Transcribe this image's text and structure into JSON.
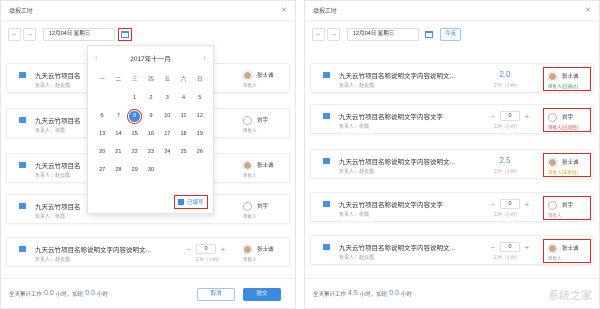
{
  "left": {
    "title": "填报工时",
    "date": "12月04日  星期三",
    "calendar": {
      "month_label": "2017年十一月",
      "weekdays": [
        "一",
        "二",
        "三",
        "四",
        "五",
        "六",
        "日"
      ],
      "days": [
        "",
        "",
        "1",
        "2",
        "3",
        "4",
        "5",
        "6",
        "7",
        "8",
        "9",
        "10",
        "11",
        "12",
        "13",
        "14",
        "15",
        "16",
        "17",
        "18",
        "19",
        "20",
        "21",
        "22",
        "23",
        "24",
        "25",
        "26",
        "27",
        "28",
        "29",
        "30",
        "",
        ""
      ],
      "selected_day": "8",
      "legend": "已填写"
    },
    "tasks": [
      {
        "title": "九天云竹项目名",
        "owner": "负责人：赵云霞",
        "hours": "",
        "unit": "",
        "approver": "张士诚",
        "role": "审批人"
      },
      {
        "title": "九天云竹项目名",
        "owner": "负责人：张霞",
        "hours": "",
        "unit": "",
        "approver": "刘宇",
        "role": "审批人"
      },
      {
        "title": "九天云竹项目名",
        "owner": "负责人：赵云霞",
        "hours": "",
        "unit": "",
        "approver": "张士诚",
        "role": "审批人"
      },
      {
        "title": "九天云竹项目名",
        "owner": "负责人：张霞",
        "hours": "",
        "unit": "",
        "approver": "刘宇",
        "role": "审批人"
      },
      {
        "title": "九天云竹项目名称说明文字内容说明文...",
        "owner": "负责人：赵云霞",
        "hours": "0",
        "unit": "工时（小时）",
        "approver": "张士诚",
        "role": "审批人"
      }
    ],
    "footer": {
      "prefix": "全天累计工作",
      "work": "0.0",
      "mid": "小时，加班",
      "overtime": "0.0",
      "suffix": "小时"
    },
    "cancel": "取消",
    "submit": "提交"
  },
  "right": {
    "title": "填报工时",
    "date": "12月04日  星期三",
    "today": "今天",
    "tasks": [
      {
        "title": "九天云竹项目名称说明文字内容说明文...",
        "owner": "负责人：赵云霞",
        "hours": "2.0",
        "unit": "工时（小时）",
        "approver": "张士诚",
        "role": "审批人(已通过)",
        "status": "ok"
      },
      {
        "title": "九天云竹项目名称说明文字内容文字",
        "owner": "负责人：张霞",
        "hours": "0",
        "unit": "工时（小时）",
        "approver": "刘宇",
        "role": "审批人(已驳回)",
        "status": "no"
      },
      {
        "title": "九天云竹项目名称说明文字内容说明文...",
        "owner": "负责人：赵云霞",
        "hours": "2.5",
        "unit": "工时（小时）",
        "approver": "张士诚",
        "role": "审批人(未审批)",
        "status": "pend"
      },
      {
        "title": "九天云竹项目名称说明文字内容文字",
        "owner": "负责人：张霞",
        "hours": "0",
        "unit": "工时（小时）",
        "approver": "刘宇",
        "role": "审批人",
        "status": ""
      },
      {
        "title": "九天云竹项目名称说明文字内容说明文...",
        "owner": "负责人：赵云霞",
        "hours": "0",
        "unit": "工时（小时）",
        "approver": "张士诚",
        "role": "审批人",
        "status": ""
      }
    ],
    "footer": {
      "prefix": "全天累计工作",
      "work": "4.5",
      "mid": "小时，加班",
      "overtime": "0.0",
      "suffix": "小时"
    }
  },
  "watermark": "系统之家",
  "colors": {
    "accent": "#3b8be0",
    "highlight": "#e02828"
  }
}
